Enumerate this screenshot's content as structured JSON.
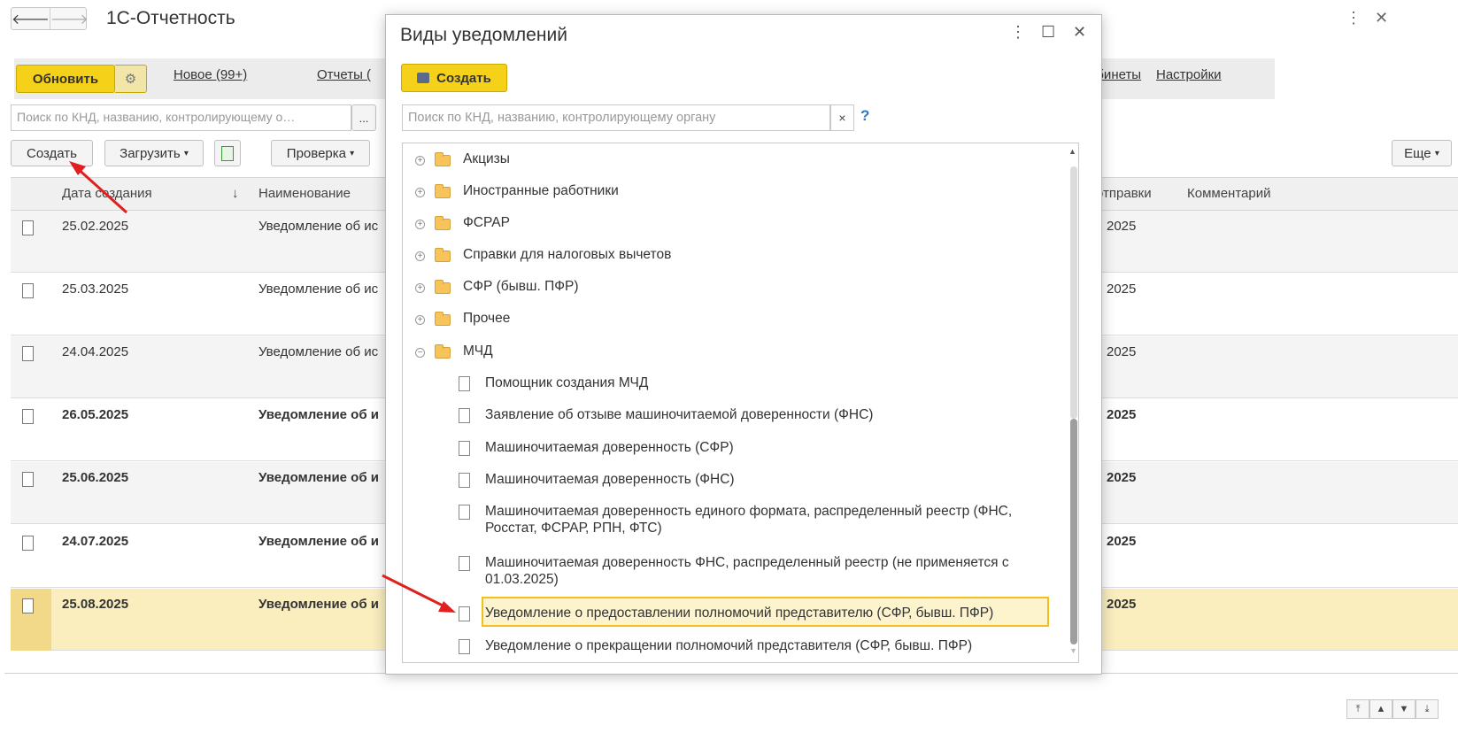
{
  "app": {
    "title": "1С-Отчетность",
    "nav_back": "🡐",
    "nav_forward": "🡒"
  },
  "toolbar": {
    "refresh_label": "Обновить",
    "new_link": "Новое (99+)",
    "reports_link": "Отчеты (",
    "cabinets_link": "абинеты",
    "settings_link": "Настройки"
  },
  "search": {
    "placeholder": "Поиск по КНД, названию, контролирующему о…",
    "dots": "..."
  },
  "actions": {
    "create_label": "Создать",
    "load_label": "Загрузить",
    "check_label": "Проверка",
    "more_label": "Еще"
  },
  "table": {
    "headers": {
      "date": "Дата создания",
      "sort": "↓",
      "name": "Наименование",
      "sent": "отправки",
      "comment": "Комментарий"
    },
    "rows": [
      {
        "date": "25.02.2025",
        "name": "Уведомление об ис",
        "sent": "2025",
        "bold": false
      },
      {
        "date": "25.03.2025",
        "name": "Уведомление об ис",
        "sent": "2025",
        "bold": false
      },
      {
        "date": "24.04.2025",
        "name": "Уведомление об ис",
        "sent": "2025",
        "bold": false
      },
      {
        "date": "26.05.2025",
        "name": "Уведомление об и",
        "sent": "2025",
        "bold": true
      },
      {
        "date": "25.06.2025",
        "name": "Уведомление об и",
        "sent": "2025",
        "bold": true
      },
      {
        "date": "24.07.2025",
        "name": "Уведомление об и",
        "sent": "2025",
        "bold": true
      },
      {
        "date": "25.08.2025",
        "name": "Уведомление об и",
        "sent": "2025",
        "bold": true
      }
    ]
  },
  "modal": {
    "title": "Виды уведомлений",
    "create_label": "Создать",
    "search_placeholder": "Поиск по КНД, названию, контролирующему органу",
    "clear": "×",
    "help": "?",
    "groups": [
      {
        "label": "Акцизы",
        "expander": "+"
      },
      {
        "label": "Иностранные работники",
        "expander": "+"
      },
      {
        "label": "ФСРАР",
        "expander": "+"
      },
      {
        "label": "Справки для налоговых вычетов",
        "expander": "+"
      },
      {
        "label": "СФР (бывш. ПФР)",
        "expander": "+"
      },
      {
        "label": "Прочее",
        "expander": "+"
      },
      {
        "label": "МЧД",
        "expander": "−"
      }
    ],
    "items": [
      {
        "line1": "Помощник создания МЧД",
        "line2": ""
      },
      {
        "line1": "Заявление об отзыве машиночитаемой доверенности (ФНС)",
        "line2": ""
      },
      {
        "line1": "Машиночитаемая доверенность (СФР)",
        "line2": ""
      },
      {
        "line1": "Машиночитаемая доверенность (ФНС)",
        "line2": ""
      },
      {
        "line1": "Машиночитаемая доверенность единого формата, распределенный реестр (ФНС,",
        "line2": "Росстат, ФСРАР, РПН, ФТС)"
      },
      {
        "line1": "Машиночитаемая доверенность ФНС, распределенный реестр (не применяется с",
        "line2": "01.03.2025)"
      },
      {
        "line1": "Уведомление о предоставлении полномочий представителю (СФР, бывш. ПФР)",
        "line2": ""
      },
      {
        "line1": "Уведомление о прекращении полномочий представителя (СФР, бывш. ПФР)",
        "line2": ""
      }
    ]
  },
  "colors": {
    "accent_yellow": "#f5d11a",
    "selection": "#faeebf",
    "arrow": "#e02020"
  },
  "icons": [
    "more-vert-icon",
    "maximize-icon",
    "close-icon",
    "gear-icon",
    "folder-icon",
    "document-icon",
    "expand-icon",
    "collapse-icon"
  ]
}
